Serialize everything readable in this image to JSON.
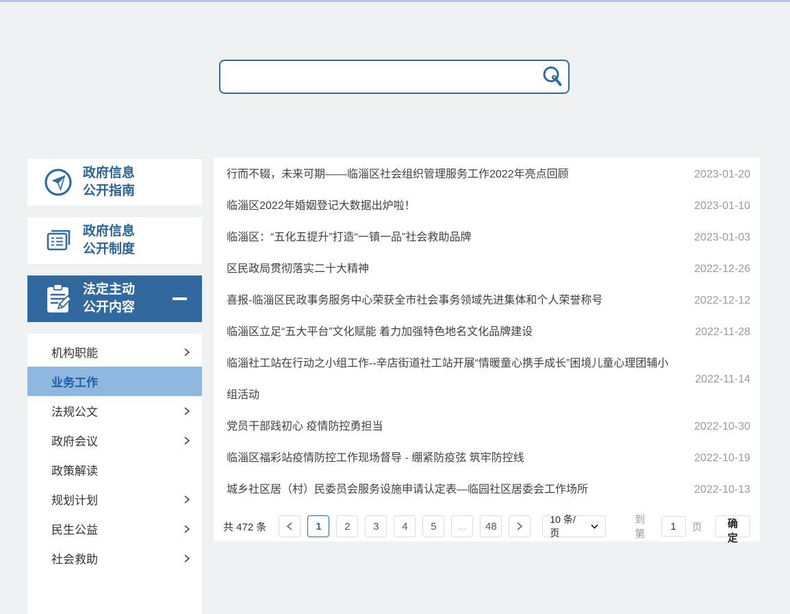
{
  "colors": {
    "accent_blue": "#2e6ba5",
    "active_block_bg": "#31699e",
    "selected_menu_bg": "#8fb7e0",
    "selected_menu_text": "#1b5fa8",
    "top_strip": "#b8c5e2",
    "page_bg": "#f0f1f2",
    "date_gray": "#9a9a9a"
  },
  "search": {
    "value": "",
    "placeholder": "",
    "icon": "search-icon"
  },
  "sidebar": {
    "blocks": [
      {
        "line1": "政府信息",
        "line2": "公开指南",
        "icon": "compass-icon",
        "active": false
      },
      {
        "line1": "政府信息",
        "line2": "公开制度",
        "icon": "document-icon",
        "active": false
      },
      {
        "line1": "法定主动",
        "line2": "公开内容",
        "icon": "clipboard-pen-icon",
        "active": true,
        "collapse_glyph": "minus-dash"
      }
    ],
    "menu": [
      {
        "label": "机构职能",
        "has_arrow": true,
        "selected": false
      },
      {
        "label": "业务工作",
        "has_arrow": false,
        "selected": true
      },
      {
        "label": "法规公文",
        "has_arrow": true,
        "selected": false
      },
      {
        "label": "政府会议",
        "has_arrow": true,
        "selected": false
      },
      {
        "label": "政策解读",
        "has_arrow": false,
        "selected": false
      },
      {
        "label": "规划计划",
        "has_arrow": true,
        "selected": false
      },
      {
        "label": "民生公益",
        "has_arrow": true,
        "selected": false
      },
      {
        "label": "社会救助",
        "has_arrow": true,
        "selected": false
      }
    ]
  },
  "list": {
    "items": [
      {
        "title": "行而不辍，未来可期——临淄区社会组织管理服务工作2022年亮点回顾",
        "date": "2023-01-20"
      },
      {
        "title": "临淄区2022年婚姻登记大数据出炉啦！",
        "date": "2023-01-10"
      },
      {
        "title": "临淄区：“五化五提升”打造“一镇一品”社会救助品牌",
        "date": "2023-01-03"
      },
      {
        "title": "区民政局贯彻落实二十大精神",
        "date": "2022-12-26"
      },
      {
        "title": "喜报-临淄区民政事务服务中心荣获全市社会事务领域先进集体和个人荣誉称号",
        "date": "2022-12-12"
      },
      {
        "title": "临淄区立足“五大平台”文化赋能 着力加强特色地名文化品牌建设",
        "date": "2022-11-28"
      },
      {
        "title": "临淄社工站在行动之小组工作--辛店街道社工站开展“情暖童心携手成长”困境儿童心理团辅小组活动",
        "date": "2022-11-14"
      },
      {
        "title": "党员干部践初心 疫情防控勇担当",
        "date": "2022-10-30"
      },
      {
        "title": "临淄区福彩站疫情防控工作现场督导 - 绷紧防疫弦 筑牢防控线",
        "date": "2022-10-19"
      },
      {
        "title": "城乡社区居（村）民委员会服务设施申请认定表—临园社区居委会工作场所",
        "date": "2022-10-13"
      }
    ]
  },
  "pagination": {
    "total_label": "共 472 条",
    "pages": [
      "1",
      "2",
      "3",
      "4",
      "5",
      "...",
      "48"
    ],
    "active_page": "1",
    "page_size_label": "10 条/页",
    "goto_prefix": "到第",
    "goto_value": "1",
    "goto_suffix": "页",
    "confirm_label": "确定"
  }
}
